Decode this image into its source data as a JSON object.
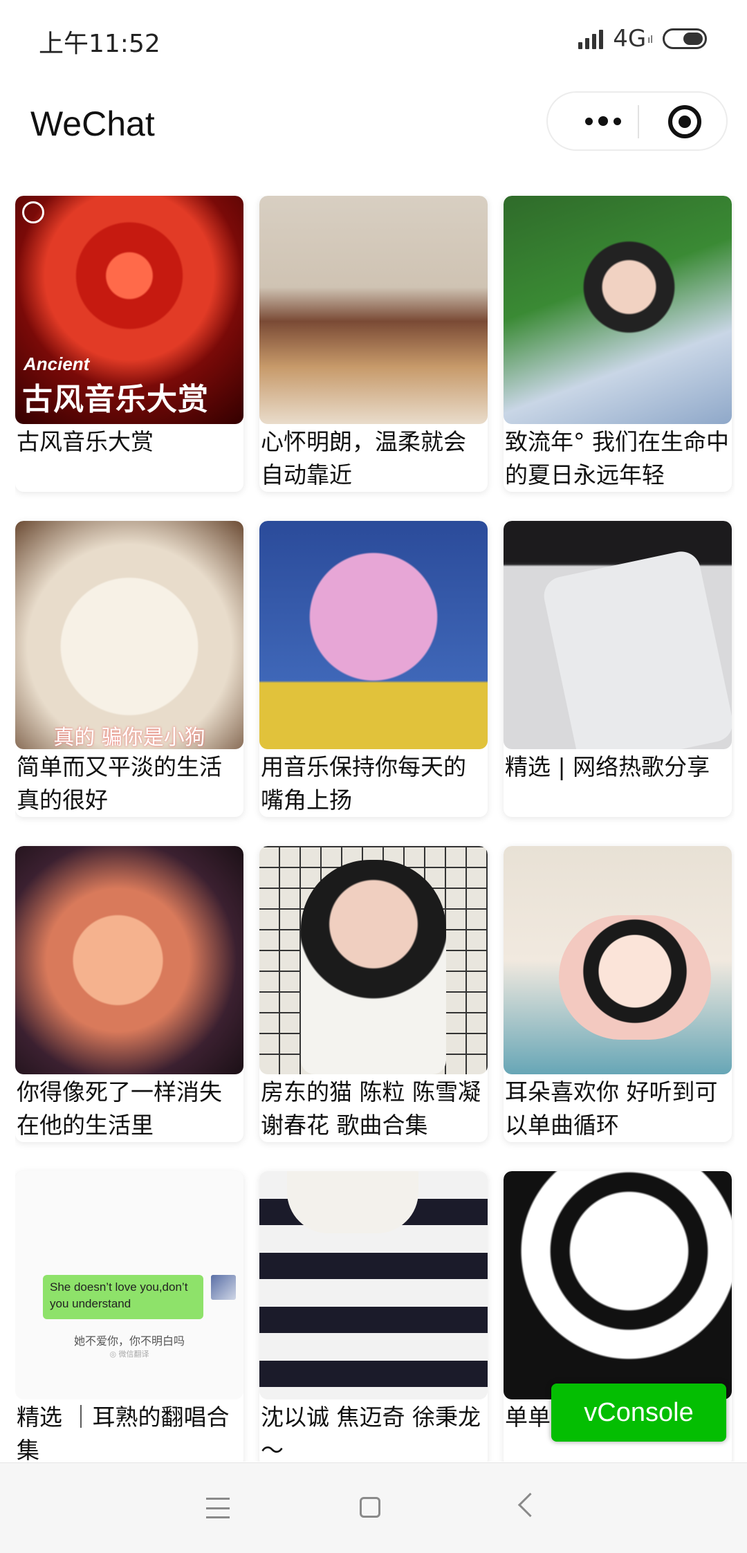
{
  "status_bar": {
    "time": "上午11:52",
    "network": "4G",
    "network_sub": "ıl"
  },
  "nav": {
    "title": "WeChat"
  },
  "cards": [
    {
      "title": "古风音乐大赏",
      "cover_text_en": "Ancient",
      "cover_text_cn": "古风音乐大赏"
    },
    {
      "title": "心怀明朗，温柔就会自动靠近"
    },
    {
      "title": "致流年° 我们在生命中的夏日永远年轻"
    },
    {
      "title": "简单而又平淡的生活真的很好",
      "cover_caption": "真的  骗你是小狗"
    },
    {
      "title": "用音乐保持你每天的嘴角上扬"
    },
    {
      "title": "精选 | 网络热歌分享"
    },
    {
      "title": "你得像死了一样消失在他的生活里"
    },
    {
      "title": "房东的猫 陈粒 陈雪凝 谢春花 歌曲合集"
    },
    {
      "title": "耳朵喜欢你 好听到可以单曲循环"
    },
    {
      "title": "精选 ｜耳熟的翻唱合集",
      "chat_bubble": "She doesn’t love you,don’t you understand",
      "chat_sub": "她不爱你，你不明白吗",
      "chat_meta": "◎ 微信翻译"
    },
    {
      "title": "沈以诚 焦迈奇 徐秉龙～"
    },
    {
      "title": "单单"
    }
  ],
  "vconsole": {
    "label": "vConsole"
  }
}
